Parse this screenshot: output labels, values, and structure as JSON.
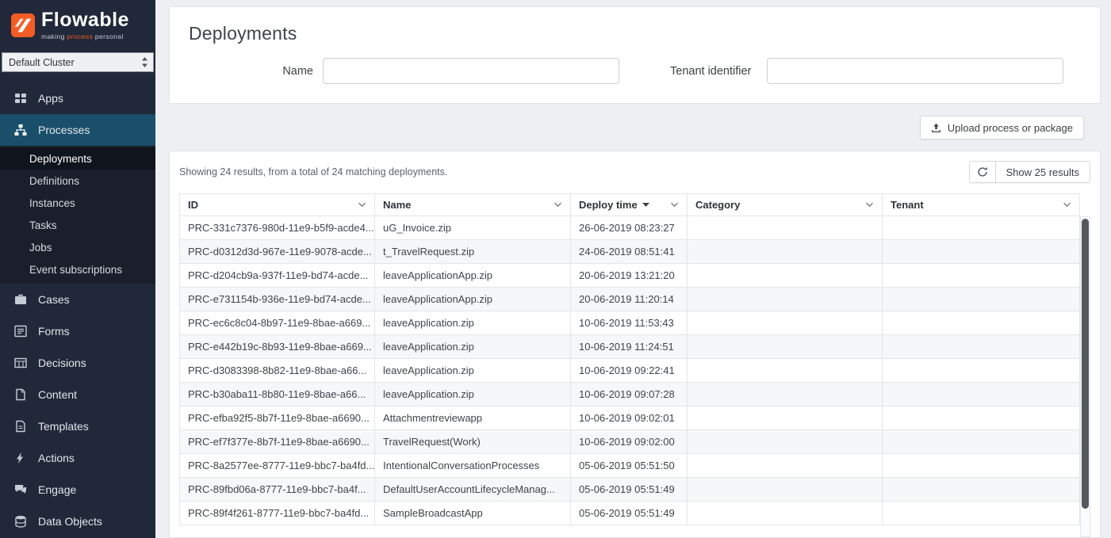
{
  "sidebar": {
    "logo": {
      "brand": "Flowable",
      "tagline_pre": "making ",
      "tagline_accent": "process",
      "tagline_post": " personal"
    },
    "cluster_select": {
      "value": "Default Cluster"
    },
    "items": [
      {
        "label": "Apps",
        "icon": "apps-icon",
        "active": false
      },
      {
        "label": "Processes",
        "icon": "processes-icon",
        "active": true
      },
      {
        "label": "Cases",
        "icon": "cases-icon",
        "active": false
      },
      {
        "label": "Forms",
        "icon": "forms-icon",
        "active": false
      },
      {
        "label": "Decisions",
        "icon": "decisions-icon",
        "active": false
      },
      {
        "label": "Content",
        "icon": "content-icon",
        "active": false
      },
      {
        "label": "Templates",
        "icon": "templates-icon",
        "active": false
      },
      {
        "label": "Actions",
        "icon": "actions-icon",
        "active": false
      },
      {
        "label": "Engage",
        "icon": "engage-icon",
        "active": false
      },
      {
        "label": "Data Objects",
        "icon": "data-objects-icon",
        "active": false
      }
    ],
    "process_subitems": [
      {
        "label": "Deployments",
        "active": true
      },
      {
        "label": "Definitions",
        "active": false
      },
      {
        "label": "Instances",
        "active": false
      },
      {
        "label": "Tasks",
        "active": false
      },
      {
        "label": "Jobs",
        "active": false
      },
      {
        "label": "Event subscriptions",
        "active": false
      }
    ]
  },
  "main": {
    "title": "Deployments",
    "filters": {
      "name_label": "Name",
      "name_value": "",
      "tenant_label": "Tenant identifier",
      "tenant_value": ""
    },
    "upload_button_label": "Upload process or package",
    "results": {
      "summary": "Showing 24 results, from a total of 24 matching deployments.",
      "show_results_label": "Show 25 results"
    },
    "table": {
      "columns": [
        "ID",
        "Name",
        "Deploy time",
        "Category",
        "Tenant"
      ],
      "sort": {
        "column": "Deploy time",
        "direction": "desc"
      },
      "rows": [
        {
          "id": "PRC-331c7376-980d-11e9-b5f9-acde4...",
          "name": "uG_Invoice.zip",
          "deploy_time": "26-06-2019 08:23:27",
          "category": "",
          "tenant": ""
        },
        {
          "id": "PRC-d0312d3d-967e-11e9-9078-acde...",
          "name": "t_TravelRequest.zip",
          "deploy_time": "24-06-2019 08:51:41",
          "category": "",
          "tenant": ""
        },
        {
          "id": "PRC-d204cb9a-937f-11e9-bd74-acde...",
          "name": "leaveApplicationApp.zip",
          "deploy_time": "20-06-2019 13:21:20",
          "category": "",
          "tenant": ""
        },
        {
          "id": "PRC-e731154b-936e-11e9-bd74-acde...",
          "name": "leaveApplicationApp.zip",
          "deploy_time": "20-06-2019 11:20:14",
          "category": "",
          "tenant": ""
        },
        {
          "id": "PRC-ec6c8c04-8b97-11e9-8bae-a669...",
          "name": "leaveApplication.zip",
          "deploy_time": "10-06-2019 11:53:43",
          "category": "",
          "tenant": ""
        },
        {
          "id": "PRC-e442b19c-8b93-11e9-8bae-a669...",
          "name": "leaveApplication.zip",
          "deploy_time": "10-06-2019 11:24:51",
          "category": "",
          "tenant": ""
        },
        {
          "id": "PRC-d3083398-8b82-11e9-8bae-a66...",
          "name": "leaveApplication.zip",
          "deploy_time": "10-06-2019 09:22:41",
          "category": "",
          "tenant": ""
        },
        {
          "id": "PRC-b30aba11-8b80-11e9-8bae-a66...",
          "name": "leaveApplication.zip",
          "deploy_time": "10-06-2019 09:07:28",
          "category": "",
          "tenant": ""
        },
        {
          "id": "PRC-efba92f5-8b7f-11e9-8bae-a6690...",
          "name": "Attachmentreviewapp",
          "deploy_time": "10-06-2019 09:02:01",
          "category": "",
          "tenant": ""
        },
        {
          "id": "PRC-ef7f377e-8b7f-11e9-8bae-a6690...",
          "name": "TravelRequest(Work)",
          "deploy_time": "10-06-2019 09:02:00",
          "category": "",
          "tenant": ""
        },
        {
          "id": "PRC-8a2577ee-8777-11e9-bbc7-ba4fd...",
          "name": "IntentionalConversationProcesses",
          "deploy_time": "05-06-2019 05:51:50",
          "category": "",
          "tenant": ""
        },
        {
          "id": "PRC-89fbd06a-8777-11e9-bbc7-ba4f...",
          "name": "DefaultUserAccountLifecycleManag...",
          "deploy_time": "05-06-2019 05:51:49",
          "category": "",
          "tenant": ""
        },
        {
          "id": "PRC-89f4f261-8777-11e9-bbc7-ba4fd...",
          "name": "SampleBroadcastApp",
          "deploy_time": "05-06-2019 05:51:49",
          "category": "",
          "tenant": ""
        }
      ]
    }
  }
}
